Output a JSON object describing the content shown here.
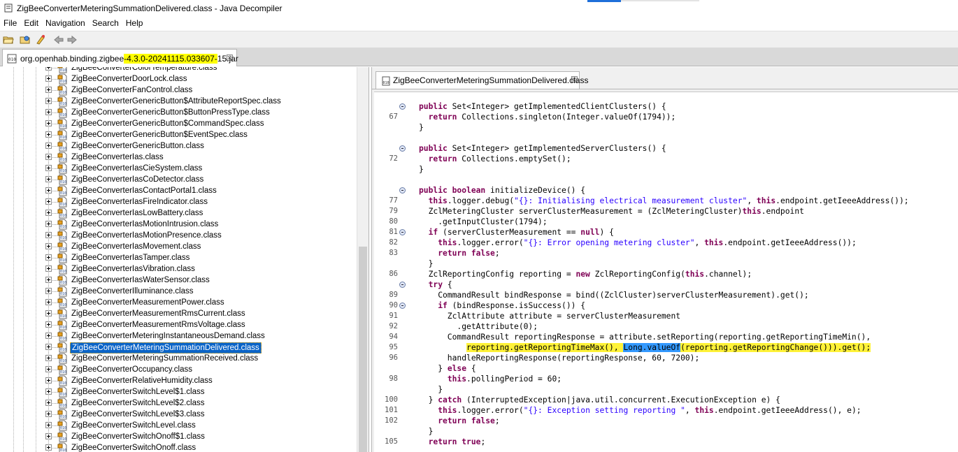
{
  "window": {
    "title": "ZigBeeConverterMeteringSummationDelivered.class - Java Decompiler"
  },
  "menu": [
    "File",
    "Edit",
    "Navigation",
    "Search",
    "Help"
  ],
  "toolbar": {
    "icons": [
      "open-file-icon",
      "open-folder-icon",
      "open-type-icon",
      "back-arrow-icon",
      "forward-arrow-icon"
    ]
  },
  "jar_tab": {
    "label_pre": "org.openhab.binding.zigbee",
    "label_highlight": "-4.3.0-20241115.033607-",
    "label_post": "15.jar",
    "close": "☒"
  },
  "tree": {
    "items": [
      "ZigBeeConverterColorTemperature.class",
      "ZigBeeConverterDoorLock.class",
      "ZigBeeConverterFanControl.class",
      "ZigBeeConverterGenericButton$AttributeReportSpec.class",
      "ZigBeeConverterGenericButton$ButtonPressType.class",
      "ZigBeeConverterGenericButton$CommandSpec.class",
      "ZigBeeConverterGenericButton$EventSpec.class",
      "ZigBeeConverterGenericButton.class",
      "ZigBeeConverterIas.class",
      "ZigBeeConverterIasCieSystem.class",
      "ZigBeeConverterIasCoDetector.class",
      "ZigBeeConverterIasContactPortal1.class",
      "ZigBeeConverterIasFireIndicator.class",
      "ZigBeeConverterIasLowBattery.class",
      "ZigBeeConverterIasMotionIntrusion.class",
      "ZigBeeConverterIasMotionPresence.class",
      "ZigBeeConverterIasMovement.class",
      "ZigBeeConverterIasTamper.class",
      "ZigBeeConverterIasVibration.class",
      "ZigBeeConverterIasWaterSensor.class",
      "ZigBeeConverterIlluminance.class",
      "ZigBeeConverterMeasurementPower.class",
      "ZigBeeConverterMeasurementRmsCurrent.class",
      "ZigBeeConverterMeasurementRmsVoltage.class",
      "ZigBeeConverterMeteringInstantaneousDemand.class",
      "ZigBeeConverterMeteringSummationDelivered.class",
      "ZigBeeConverterMeteringSummationReceived.class",
      "ZigBeeConverterOccupancy.class",
      "ZigBeeConverterRelativeHumidity.class",
      "ZigBeeConverterSwitchLevel$1.class",
      "ZigBeeConverterSwitchLevel$2.class",
      "ZigBeeConverterSwitchLevel$3.class",
      "ZigBeeConverterSwitchLevel.class",
      "ZigBeeConverterSwitchOnoff$1.class",
      "ZigBeeConverterSwitchOnoff.class"
    ],
    "selected_index": 25
  },
  "class_tab": {
    "label": "ZigBeeConverterMeteringSummationDelivered.class",
    "close": "☒"
  },
  "code": [
    {
      "ln": "",
      "fold": true,
      "html": "<span class=\"kw\">public</span> Set&lt;Integer&gt; getImplementedClientClusters() {"
    },
    {
      "ln": "67",
      "fold": false,
      "html": "  <span class=\"kw\">return</span> Collections.singleton(Integer.valueOf(1794));"
    },
    {
      "ln": "",
      "fold": false,
      "html": "}"
    },
    {
      "ln": "",
      "fold": false,
      "html": ""
    },
    {
      "ln": "",
      "fold": true,
      "html": "<span class=\"kw\">public</span> Set&lt;Integer&gt; getImplementedServerClusters() {"
    },
    {
      "ln": "72",
      "fold": false,
      "html": "  <span class=\"kw\">return</span> Collections.emptySet();"
    },
    {
      "ln": "",
      "fold": false,
      "html": "}"
    },
    {
      "ln": "",
      "fold": false,
      "html": ""
    },
    {
      "ln": "",
      "fold": true,
      "html": "<span class=\"kw\">public boolean</span> initializeDevice() {"
    },
    {
      "ln": "77",
      "fold": false,
      "html": "  <span class=\"kw\">this</span>.logger.debug(<span class=\"str\">\"{}: Initialising electrical measurement cluster\"</span>, <span class=\"kw\">this</span>.endpoint.getIeeeAddress());"
    },
    {
      "ln": "79",
      "fold": false,
      "html": "  ZclMeteringCluster serverClusterMeasurement = (ZclMeteringCluster)<span class=\"kw\">this</span>.endpoint"
    },
    {
      "ln": "80",
      "fold": false,
      "html": "    .getInputCluster(1794);"
    },
    {
      "ln": "81",
      "fold": true,
      "html": "  <span class=\"kw\">if</span> (serverClusterMeasurement == <span class=\"kw\">null</span>) {"
    },
    {
      "ln": "82",
      "fold": false,
      "html": "    <span class=\"kw\">this</span>.logger.error(<span class=\"str\">\"{}: Error opening metering cluster\"</span>, <span class=\"kw\">this</span>.endpoint.getIeeeAddress());"
    },
    {
      "ln": "83",
      "fold": false,
      "html": "    <span class=\"kw\">return false</span>;"
    },
    {
      "ln": "",
      "fold": false,
      "html": "  }"
    },
    {
      "ln": "86",
      "fold": false,
      "html": "  ZclReportingConfig reporting = <span class=\"kw\">new</span> ZclReportingConfig(<span class=\"kw\">this</span>.channel);"
    },
    {
      "ln": "",
      "fold": true,
      "html": "  <span class=\"kw\">try</span> {"
    },
    {
      "ln": "89",
      "fold": false,
      "html": "    CommandResult bindResponse = bind((ZclCluster)serverClusterMeasurement).get();"
    },
    {
      "ln": "90",
      "fold": true,
      "html": "    <span class=\"kw\">if</span> (bindResponse.isSuccess()) {"
    },
    {
      "ln": "91",
      "fold": false,
      "html": "      ZclAttribute attribute = serverClusterMeasurement"
    },
    {
      "ln": "92",
      "fold": false,
      "html": "        .getAttribute(0);"
    },
    {
      "ln": "94",
      "fold": false,
      "html": "      CommandResult reportingResponse = attribute.setReporting(reporting.getReportingTimeMin(),"
    },
    {
      "ln": "95",
      "fold": false,
      "html": "          <span class=\"yl\">reporting.getReportingTimeMax(), </span><span class=\"bl\">Long.valueOf</span><span class=\"yl\">(reporting.getReportingChange())).get();</span>"
    },
    {
      "ln": "96",
      "fold": false,
      "html": "      handleReportingResponse(reportingResponse, 60, 7200);"
    },
    {
      "ln": "",
      "fold": false,
      "html": "    } <span class=\"kw\">else</span> {"
    },
    {
      "ln": "98",
      "fold": false,
      "html": "      <span class=\"kw\">this</span>.pollingPeriod = 60;"
    },
    {
      "ln": "",
      "fold": false,
      "html": "    }"
    },
    {
      "ln": "100",
      "fold": false,
      "html": "  } <span class=\"kw\">catch</span> (InterruptedException|java.util.concurrent.ExecutionException e) {"
    },
    {
      "ln": "101",
      "fold": false,
      "html": "    <span class=\"kw\">this</span>.logger.error(<span class=\"str\">\"{}: Exception setting reporting \"</span>, <span class=\"kw\">this</span>.endpoint.getIeeeAddress(), e);"
    },
    {
      "ln": "102",
      "fold": false,
      "html": "    <span class=\"kw\">return false</span>;"
    },
    {
      "ln": "",
      "fold": false,
      "html": "  }"
    },
    {
      "ln": "105",
      "fold": false,
      "html": "  <span class=\"kw\">return true</span>;"
    }
  ],
  "colors": {
    "keyword": "#7f0055",
    "string": "#2a00ff",
    "selection": "#0a64c8",
    "highlight_yellow": "#fff238",
    "highlight_blue": "#3399ff"
  }
}
